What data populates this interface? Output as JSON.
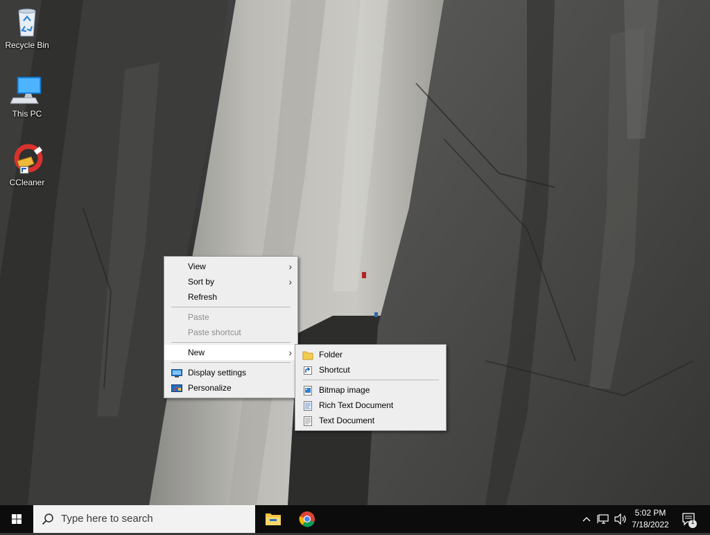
{
  "desktop": {
    "icons": [
      {
        "label": "Recycle Bin",
        "icon": "recycle-bin-icon"
      },
      {
        "label": "This PC",
        "icon": "computer-icon"
      },
      {
        "label": "CCleaner",
        "icon": "ccleaner-icon"
      }
    ]
  },
  "context_menu": {
    "items": [
      {
        "label": "View",
        "submenu": true
      },
      {
        "label": "Sort by",
        "submenu": true
      },
      {
        "label": "Refresh"
      },
      {
        "label": "Paste",
        "disabled": true
      },
      {
        "label": "Paste shortcut",
        "disabled": true
      },
      {
        "label": "New",
        "submenu": true,
        "highlighted": true
      },
      {
        "label": "Display settings",
        "icon": "display-icon"
      },
      {
        "label": "Personalize",
        "icon": "personalize-icon"
      }
    ]
  },
  "new_submenu": {
    "items": [
      {
        "label": "Folder",
        "icon": "folder-icon"
      },
      {
        "label": "Shortcut",
        "icon": "shortcut-icon"
      },
      {
        "label": "Bitmap image",
        "icon": "bitmap-icon"
      },
      {
        "label": "Rich Text Document",
        "icon": "rich-text-icon"
      },
      {
        "label": "Text Document",
        "icon": "text-document-icon"
      }
    ]
  },
  "taskbar": {
    "search_placeholder": "Type here to search",
    "pinned_apps": [
      "file-explorer-icon",
      "chrome-icon"
    ],
    "clock": {
      "time": "5:02 PM",
      "date": "7/18/2022"
    },
    "notification_count": "1"
  },
  "colors": {
    "taskbar": "#0c0c0c",
    "menu_bg": "#eeeeee",
    "menu_highlight": "#ffffff",
    "disabled_text": "#8d8d8d",
    "search_bg": "#f2f2f2"
  }
}
